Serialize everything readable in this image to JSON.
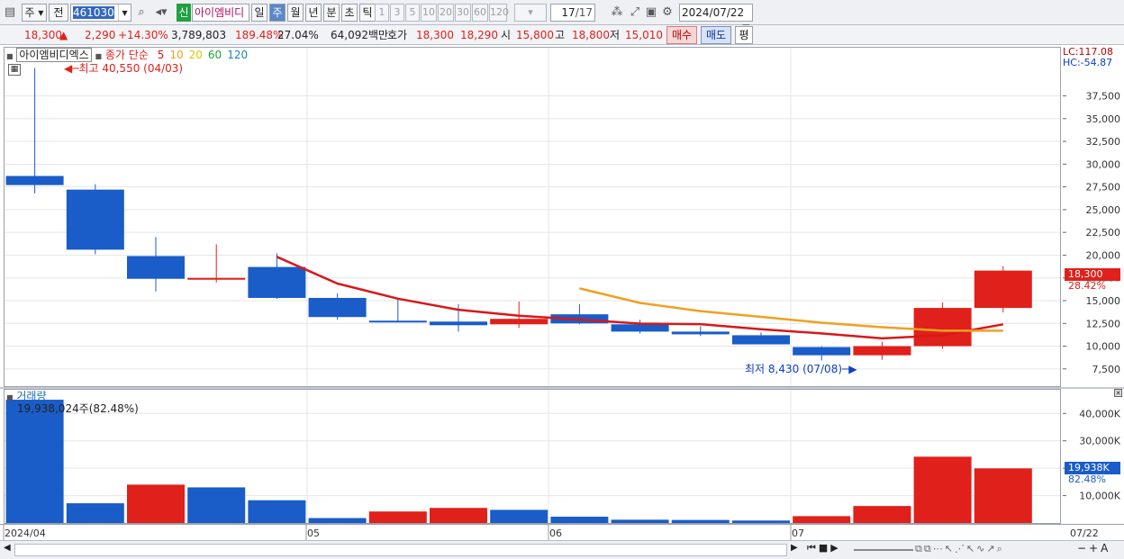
{
  "toolbar": {
    "period_type": "주",
    "prefix": "전",
    "code": "461030",
    "badge": "신",
    "name": "아이엠비디",
    "periods": [
      "일",
      "주",
      "월",
      "년",
      "분",
      "초",
      "틱"
    ],
    "active_period": "주",
    "intervals": [
      "1",
      "3",
      "5",
      "10",
      "20",
      "30",
      "60",
      "120"
    ],
    "count": "17",
    "count_total": "/17",
    "date": "2024/07/22"
  },
  "quote": {
    "price": "18,300",
    "change": "2,290",
    "change_pct": "+14.30%",
    "volume": "3,789,803",
    "volume_ratio": "189.48%",
    "turnover": "27.04%",
    "amount": "64,092백만",
    "hoga_label": "호가",
    "ask": "18,300",
    "bid": "18,290",
    "open_label": "시",
    "open": "15,800",
    "high_label": "고",
    "high": "18,800",
    "low_label": "저",
    "low": "15,010",
    "buy_btn": "매수",
    "sell_btn": "매도",
    "eval_btn": "평"
  },
  "colors": {
    "up": "#e0201a",
    "down": "#1a5cc8",
    "ma5": "#d81818",
    "ma10": "#f0a020",
    "ma20": "#e0c800",
    "ma60": "#20a040",
    "ma120": "#2080c0"
  },
  "price_legend": {
    "name": "아이엠비디엑스",
    "ma_label": "종가 단순",
    "ma_periods": [
      "5",
      "10",
      "20",
      "60",
      "120"
    ]
  },
  "annotations": {
    "high": "최고 40,550 (04/03)",
    "low": "최저 8,430 (07/08)"
  },
  "right_labels": {
    "lc": "LC:117.08",
    "hc": "HC:-54.87",
    "price_tag": "18,300",
    "price_pct": "28.42%",
    "vol_tag": "19,938K",
    "vol_pct": "82.48%"
  },
  "volume_legend": {
    "title": "거래량",
    "value": "19,938,024주(82.48%)"
  },
  "x_labels": [
    "2024/04",
    "05",
    "06",
    "07",
    "07/22"
  ],
  "chart_data": [
    {
      "type": "candlestick",
      "ylim": [
        6000,
        42000
      ],
      "yticks": [
        7500,
        10000,
        12500,
        15000,
        17500,
        20000,
        22500,
        25000,
        27500,
        30000,
        32500,
        35000,
        37500
      ],
      "ytick_labels": [
        "7,500",
        "10,000",
        "12,500",
        "15,000",
        "17,500",
        "20,000",
        "22,500",
        "25,000",
        "27,500",
        "30,000",
        "32,500",
        "35,000",
        "37,500"
      ],
      "candles": [
        {
          "o": 28700,
          "h": 40550,
          "l": 26800,
          "c": 27700
        },
        {
          "o": 27200,
          "h": 27800,
          "l": 20100,
          "c": 20600
        },
        {
          "o": 19900,
          "h": 22000,
          "l": 16000,
          "c": 17400
        },
        {
          "o": 17300,
          "h": 21200,
          "l": 17000,
          "c": 17500
        },
        {
          "o": 18700,
          "h": 20200,
          "l": 15200,
          "c": 15300
        },
        {
          "o": 15300,
          "h": 15800,
          "l": 12900,
          "c": 13200
        },
        {
          "o": 12800,
          "h": 15200,
          "l": 12600,
          "c": 12700
        },
        {
          "o": 12700,
          "h": 14600,
          "l": 11600,
          "c": 12300
        },
        {
          "o": 12400,
          "h": 14900,
          "l": 12000,
          "c": 13000
        },
        {
          "o": 13500,
          "h": 14600,
          "l": 12400,
          "c": 12500
        },
        {
          "o": 12400,
          "h": 12900,
          "l": 11400,
          "c": 11600
        },
        {
          "o": 11600,
          "h": 12200,
          "l": 11100,
          "c": 11300
        },
        {
          "o": 11200,
          "h": 11500,
          "l": 10300,
          "c": 10200
        },
        {
          "o": 9900,
          "h": 10000,
          "l": 8430,
          "c": 9000
        },
        {
          "o": 9000,
          "h": 10500,
          "l": 8500,
          "c": 10000
        },
        {
          "o": 10000,
          "h": 14800,
          "l": 9700,
          "c": 14200
        },
        {
          "o": 14200,
          "h": 18800,
          "l": 13700,
          "c": 18300
        }
      ],
      "series": [
        {
          "name": "5",
          "values": [
            null,
            null,
            null,
            null,
            19820,
            16880,
            15220,
            14000,
            13340,
            12920,
            12480,
            12420,
            11860,
            11400,
            10860,
            11200,
            12400
          ]
        },
        {
          "name": "10",
          "values": [
            null,
            null,
            null,
            null,
            null,
            null,
            null,
            null,
            null,
            16350,
            14750,
            13850,
            13220,
            12580,
            12080,
            11700,
            11700
          ]
        }
      ]
    },
    {
      "type": "bar",
      "title": "거래량",
      "ylim": [
        0,
        46000
      ],
      "yticks": [
        10000,
        20000,
        30000,
        40000
      ],
      "ytick_labels": [
        "10,000K",
        "20,000K",
        "30,000K",
        "40,000K"
      ],
      "values": [
        45000,
        7200,
        14000,
        13000,
        8300,
        1800,
        4200,
        5500,
        4800,
        2300,
        1200,
        1100,
        900,
        2500,
        6200,
        24200,
        19938
      ],
      "up": [
        false,
        false,
        true,
        false,
        false,
        false,
        true,
        true,
        false,
        false,
        false,
        false,
        false,
        true,
        true,
        true,
        true
      ]
    }
  ]
}
